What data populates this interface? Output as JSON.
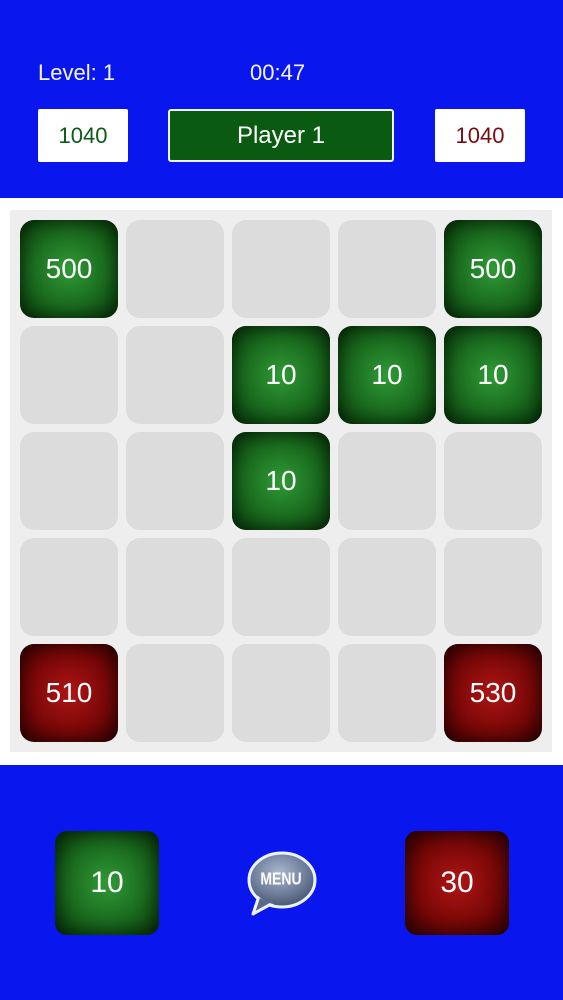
{
  "header": {
    "level_label": "Level: 1",
    "timer": "00:47",
    "player1_score": "1040",
    "player2_score": "1040",
    "current_player": "Player 1"
  },
  "board": {
    "rows": 5,
    "cols": 5,
    "tiles": [
      {
        "row": 0,
        "col": 0,
        "value": "500",
        "owner": "green"
      },
      {
        "row": 0,
        "col": 4,
        "value": "500",
        "owner": "green"
      },
      {
        "row": 1,
        "col": 2,
        "value": "10",
        "owner": "green"
      },
      {
        "row": 1,
        "col": 3,
        "value": "10",
        "owner": "green"
      },
      {
        "row": 1,
        "col": 4,
        "value": "10",
        "owner": "green"
      },
      {
        "row": 2,
        "col": 2,
        "value": "10",
        "owner": "green"
      },
      {
        "row": 4,
        "col": 0,
        "value": "510",
        "owner": "red"
      },
      {
        "row": 4,
        "col": 4,
        "value": "530",
        "owner": "red"
      }
    ]
  },
  "footer": {
    "green_next": "10",
    "red_next": "30",
    "menu_label": "MENU"
  },
  "colors": {
    "background_blue": "#0a16ee",
    "green_player": "#1a6a1e",
    "red_player": "#7a0808",
    "empty_cell": "#dcdcdc",
    "board_bg": "#eeeeee"
  }
}
